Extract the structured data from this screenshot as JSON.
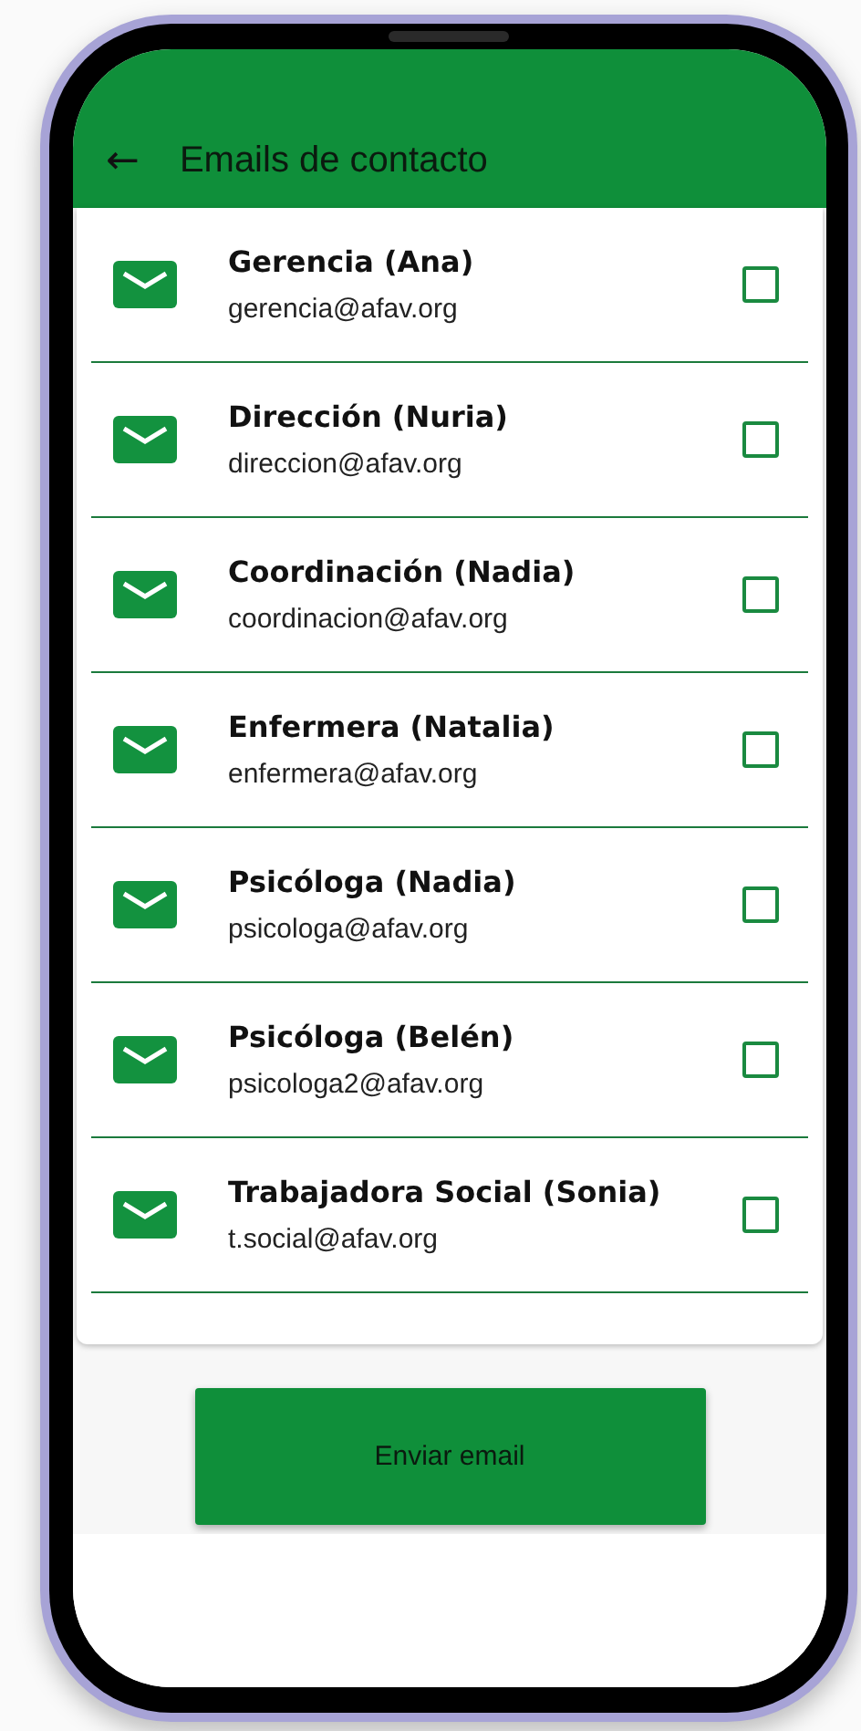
{
  "app_bar": {
    "back_icon": "←",
    "title": "Emails de contacto"
  },
  "contacts": [
    {
      "name": "Gerencia (Ana)",
      "email": "gerencia@afav.org",
      "checked": false
    },
    {
      "name": "Dirección (Nuria)",
      "email": "direccion@afav.org",
      "checked": false
    },
    {
      "name": "Coordinación (Nadia)",
      "email": "coordinacion@afav.org",
      "checked": false
    },
    {
      "name": "Enfermera (Natalia)",
      "email": "enfermera@afav.org",
      "checked": false
    },
    {
      "name": "Psicóloga (Nadia)",
      "email": "psicologa@afav.org",
      "checked": false
    },
    {
      "name": "Psicóloga (Belén)",
      "email": "psicologa2@afav.org",
      "checked": false
    },
    {
      "name": "Trabajadora Social (Sonia)",
      "email": "t.social@afav.org",
      "checked": false
    }
  ],
  "send_button": {
    "label": "Enviar email"
  }
}
